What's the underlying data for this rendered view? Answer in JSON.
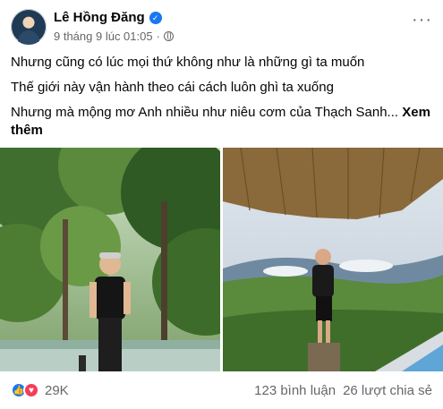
{
  "post": {
    "author": "Lê Hồng Đăng",
    "timestamp": "9 tháng 9 lúc 01:05",
    "privacy_icon": "globe-icon",
    "verified_icon": "verified-badge-icon",
    "more_icon": "more-options-icon",
    "more_label": "···",
    "lines": [
      "Nhưng cũng có lúc mọi thứ không như là những gì ta muốn",
      "Thế giới này vận hành theo cái cách luôn ghì ta xuống",
      "Nhưng mà mộng mơ Anh nhiều như niêu cơm của Thạch Sanh... "
    ],
    "see_more": "Xem thêm"
  },
  "photos": [
    {
      "name": "photo-forest",
      "scene": "man in forest"
    },
    {
      "name": "photo-mountain-view",
      "scene": "man overlooking mountains"
    }
  ],
  "footer": {
    "reaction_count": "29K",
    "comments": "123 bình luận",
    "shares": "26 lượt chia sẻ",
    "like_icon": "like-reaction-icon",
    "love_icon": "love-reaction-icon"
  },
  "colors": {
    "brand_blue": "#1877f2",
    "love_red": "#f33e58",
    "secondary_text": "#65676b"
  }
}
